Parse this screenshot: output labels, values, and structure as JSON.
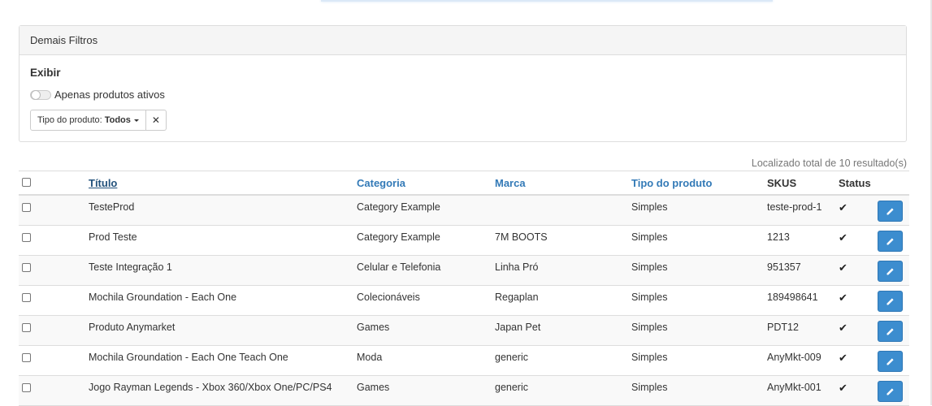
{
  "filters": {
    "heading": "Demais Filtros",
    "exibir_label": "Exibir",
    "active_toggle_label": "Apenas produtos ativos",
    "product_type_label": "Tipo do produto:",
    "product_type_value": "Todos"
  },
  "results": {
    "total_text": "Localizado total de 10 resultado(s)"
  },
  "table": {
    "columns": {
      "titulo": "Título",
      "categoria": "Categoria",
      "marca": "Marca",
      "tipo": "Tipo do produto",
      "skus": "SKUS",
      "status": "Status"
    },
    "rows": [
      {
        "titulo": "TesteProd",
        "categoria": "Category Example",
        "marca": "",
        "tipo": "Simples",
        "sku": "teste-prod-1",
        "status": "✔"
      },
      {
        "titulo": "Prod Teste",
        "categoria": "Category Example",
        "marca": "7M BOOTS",
        "tipo": "Simples",
        "sku": "1213",
        "status": "✔"
      },
      {
        "titulo": "Teste Integração 1",
        "categoria": "Celular e Telefonia",
        "marca": "Linha Pró",
        "tipo": "Simples",
        "sku": "951357",
        "status": "✔"
      },
      {
        "titulo": "Mochila Groundation - Each One",
        "categoria": "Colecionáveis",
        "marca": "Regaplan",
        "tipo": "Simples",
        "sku": "189498641",
        "status": "✔"
      },
      {
        "titulo": "Produto Anymarket",
        "categoria": "Games",
        "marca": "Japan Pet",
        "tipo": "Simples",
        "sku": "PDT12",
        "status": "✔"
      },
      {
        "titulo": "Mochila Groundation - Each One Teach One",
        "categoria": "Moda",
        "marca": "generic",
        "tipo": "Simples",
        "sku": "AnyMkt-009",
        "status": "✔"
      },
      {
        "titulo": "Jogo Rayman Legends - Xbox 360/Xbox One/PC/PS4",
        "categoria": "Games",
        "marca": "generic",
        "tipo": "Simples",
        "sku": "AnyMkt-001",
        "status": "✔"
      }
    ]
  },
  "icons": {
    "edit": "pencil-icon",
    "status": "check-icon",
    "remove_filter": "close-icon"
  },
  "colors": {
    "accent": "#337ab7",
    "edit_button": "#3c8dcf"
  }
}
